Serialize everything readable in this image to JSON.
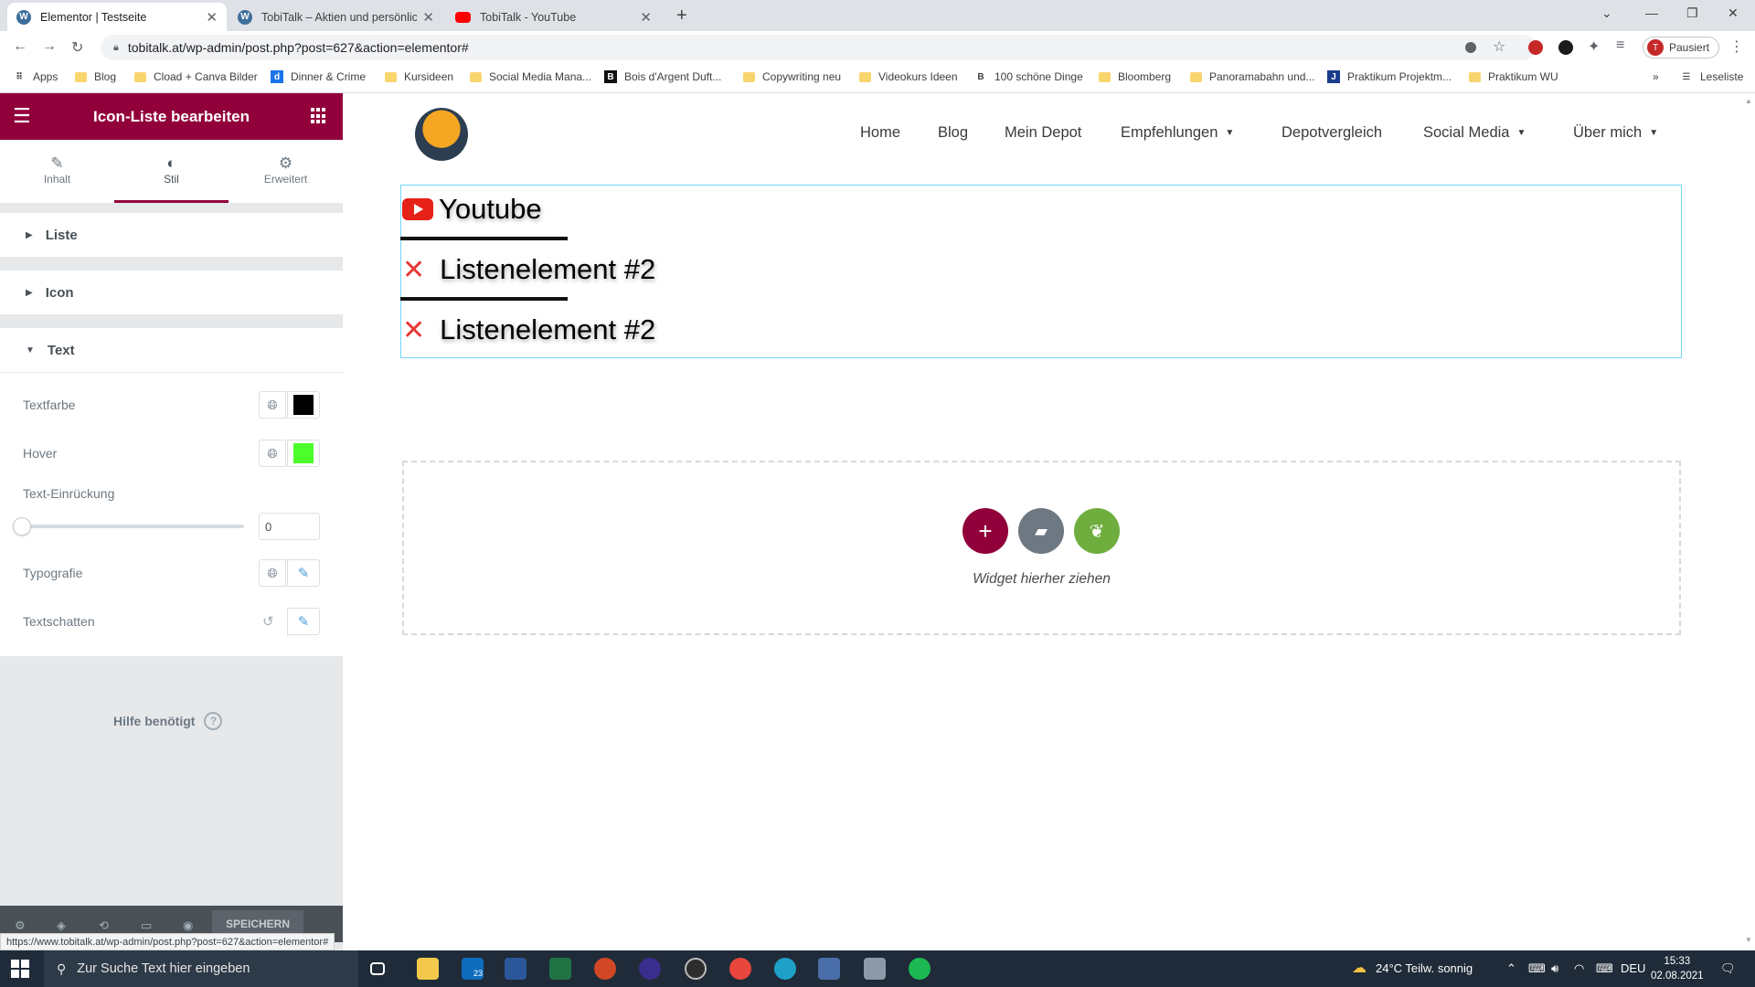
{
  "browser": {
    "tabs": [
      {
        "title": "Elementor | Testseite",
        "icon": "wordpress-icon",
        "active": true
      },
      {
        "title": "TobiTalk – Aktien und persönliche",
        "icon": "wordpress-icon",
        "active": false
      },
      {
        "title": "TobiTalk - YouTube",
        "icon": "youtube-icon",
        "active": false
      }
    ],
    "url": "tobitalk.at/wp-admin/post.php?post=627&action=elementor#",
    "profile_label": "Pausiert",
    "profile_initial": "T",
    "bookmarks": [
      {
        "label": "Apps",
        "icon": "apps-icon"
      },
      {
        "label": "Blog",
        "icon": "folder-icon"
      },
      {
        "label": "Cload + Canva Bilder",
        "icon": "folder-icon"
      },
      {
        "label": "Dinner & Crime",
        "icon": "site-icon"
      },
      {
        "label": "Kursideen",
        "icon": "folder-icon"
      },
      {
        "label": "Social Media Mana...",
        "icon": "folder-icon"
      },
      {
        "label": "Bois d'Argent Duft...",
        "icon": "site-icon"
      },
      {
        "label": "Copywriting neu",
        "icon": "folder-icon"
      },
      {
        "label": "Videokurs Ideen",
        "icon": "folder-icon"
      },
      {
        "label": "100 schöne Dinge",
        "icon": "site-icon"
      },
      {
        "label": "Bloomberg",
        "icon": "folder-icon"
      },
      {
        "label": "Panoramabahn und...",
        "icon": "folder-icon"
      },
      {
        "label": "Praktikum Projektm...",
        "icon": "site-icon"
      },
      {
        "label": "Praktikum WU",
        "icon": "folder-icon"
      }
    ],
    "reading_list": "Leseliste",
    "status_url": "https://www.tobitalk.at/wp-admin/post.php?post=627&action=elementor#"
  },
  "panel": {
    "title": "Icon-Liste bearbeiten",
    "tabs": [
      {
        "label": "Inhalt",
        "icon": "pencil-icon"
      },
      {
        "label": "Stil",
        "icon": "contrast-icon"
      },
      {
        "label": "Erweitert",
        "icon": "gear-icon"
      }
    ],
    "sections": {
      "liste": "Liste",
      "icon": "Icon",
      "text": "Text"
    },
    "controls": {
      "textfarbe": {
        "label": "Textfarbe",
        "color": "#000000"
      },
      "hover": {
        "label": "Hover",
        "color": "#4cff2b"
      },
      "einrueckung": {
        "label": "Text-Einrückung",
        "value": "0"
      },
      "typografie": {
        "label": "Typografie"
      },
      "textschatten": {
        "label": "Textschatten"
      }
    },
    "help": "Hilfe benötigt",
    "save": "SPEICHERN"
  },
  "site": {
    "nav": [
      {
        "label": "Home",
        "dropdown": false
      },
      {
        "label": "Blog",
        "dropdown": false
      },
      {
        "label": "Mein Depot",
        "dropdown": false
      },
      {
        "label": "Empfehlungen",
        "dropdown": true
      },
      {
        "label": "Depotvergleich",
        "dropdown": false
      },
      {
        "label": "Social Media",
        "dropdown": true
      },
      {
        "label": "Über mich",
        "dropdown": true
      }
    ],
    "icon_list": [
      {
        "text": "Youtube",
        "icon": "youtube-icon"
      },
      {
        "text": "Listenelement #2",
        "icon": "close-icon"
      },
      {
        "text": "Listenelement #2",
        "icon": "close-icon"
      }
    ],
    "dropzone_text": "Widget hierher ziehen"
  },
  "taskbar": {
    "search_placeholder": "Zur Suche Text hier eingeben",
    "mail_badge": "23",
    "weather": "24°C Teilw. sonnig",
    "language": "DEU",
    "time": "15:33",
    "date": "02.08.2021"
  }
}
